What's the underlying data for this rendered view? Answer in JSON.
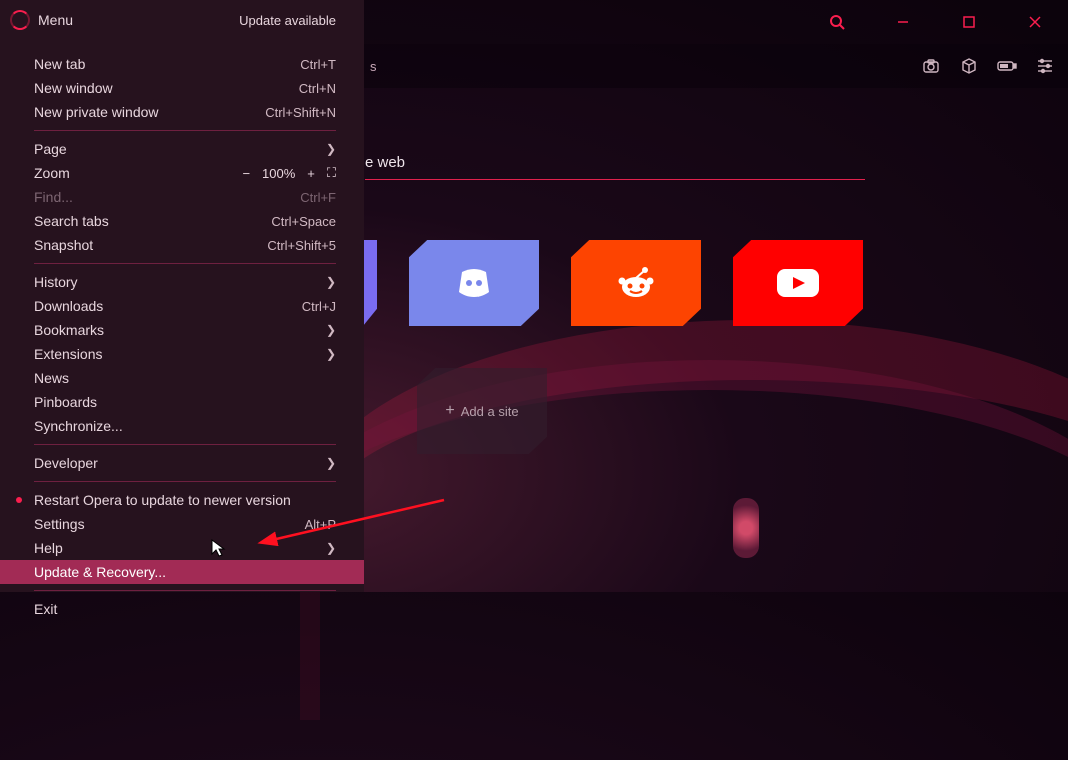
{
  "titlebar": {
    "search_icon": "search-icon",
    "minimize": "—",
    "maximize": "□",
    "close": "×"
  },
  "addrbar": {
    "suffix": "s",
    "icon_camera": "camera-icon",
    "icon_cube": "cube-icon",
    "icon_battery": "battery-icon",
    "icon_sliders": "sliders-icon"
  },
  "main": {
    "heading_suffix": "e web",
    "tiles": {
      "discord": "Discord",
      "reddit": "Reddit",
      "youtube": "YouTube",
      "add": "Add a site"
    }
  },
  "menu": {
    "title": "Menu",
    "update_avail": "Update available",
    "groups": [
      [
        {
          "label": "New tab",
          "shortcut": "Ctrl+T"
        },
        {
          "label": "New window",
          "shortcut": "Ctrl+N"
        },
        {
          "label": "New private window",
          "shortcut": "Ctrl+Shift+N"
        }
      ],
      [
        {
          "label": "Page",
          "sub": true
        },
        {
          "label": "Zoom",
          "zoom": true,
          "zoom_value": "100%"
        },
        {
          "label": "Find...",
          "shortcut": "Ctrl+F",
          "disabled": true
        },
        {
          "label": "Search tabs",
          "shortcut": "Ctrl+Space"
        },
        {
          "label": "Snapshot",
          "shortcut": "Ctrl+Shift+5"
        }
      ],
      [
        {
          "label": "History",
          "sub": true
        },
        {
          "label": "Downloads",
          "shortcut": "Ctrl+J"
        },
        {
          "label": "Bookmarks",
          "sub": true
        },
        {
          "label": "Extensions",
          "sub": true
        },
        {
          "label": "News"
        },
        {
          "label": "Pinboards"
        },
        {
          "label": "Synchronize..."
        }
      ],
      [
        {
          "label": "Developer",
          "sub": true
        }
      ],
      [
        {
          "label": "Restart Opera to update to newer version",
          "dot": true
        },
        {
          "label": "Settings",
          "shortcut": "Alt+P"
        },
        {
          "label": "Help",
          "sub": true
        },
        {
          "label": "Update & Recovery...",
          "highlight": true
        }
      ],
      [
        {
          "label": "Exit"
        }
      ]
    ],
    "zoom_minus": "−",
    "zoom_plus": "+",
    "full_icon": "⛶"
  }
}
